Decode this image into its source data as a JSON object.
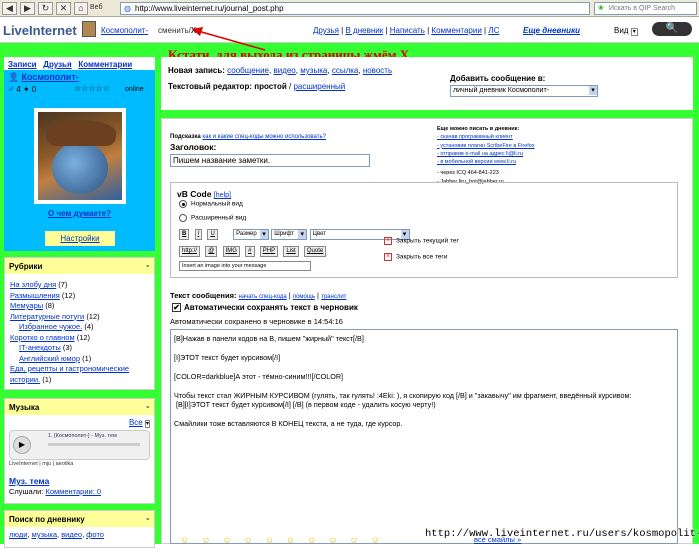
{
  "browser": {
    "web_label": "Веб",
    "url": "http://www.liveinternet.ru/journal_post.php",
    "search_placeholder": "Искать в QIP Search"
  },
  "topbar": {
    "logo": "LiveInternet",
    "username": "Космополит-",
    "change": "сменить",
    "close_x": "X",
    "links": [
      "Друзья",
      "В дневник",
      "Написать",
      "Комментарии",
      "ЛС"
    ],
    "journal_btn": "Еще дневники",
    "view_label": "Вид"
  },
  "annotations": {
    "exit_hint": "Кстати, для выхода из страницы жмём Х",
    "watermark": "http://www.liveinternet.ru/users/kosmopolit-/"
  },
  "sidebar": {
    "profile_links": [
      "Записи",
      "Друзья",
      "Комментарии"
    ],
    "username": "Космополит-",
    "stars": "☆☆☆☆☆",
    "status": "online",
    "mood_link": "О чем думаете?",
    "settings": "Настройки",
    "rubrics_title": "Рубрики",
    "rubrics": [
      {
        "name": "На злобу дня",
        "count": "(7)",
        "indent": false
      },
      {
        "name": "Размышления",
        "count": "(12)",
        "indent": false
      },
      {
        "name": "Мемуары",
        "count": "(8)",
        "indent": false
      },
      {
        "name": "Литературные потуги",
        "count": "(12)",
        "indent": false
      },
      {
        "name": "Избранное чужое.",
        "count": "(4)",
        "indent": true
      },
      {
        "name": "Коротко о главном",
        "count": "(12)",
        "indent": false
      },
      {
        "name": "IT-анекдоты",
        "count": "(3)",
        "indent": true
      },
      {
        "name": "Английский юмор",
        "count": "(1)",
        "indent": true
      },
      {
        "name": "Еда, рецепты и гастрономические истории.",
        "count": "(1)",
        "indent": false
      }
    ],
    "music_title": "Музыка",
    "music_all": "Все",
    "music_track": "1. [Космополит-] - Муз. тем",
    "music_brand": "LiveInternet",
    "music_brand2": "mju",
    "music_brand3": "aeotika",
    "music_theme": "Муз. тема",
    "listened": "Слушали:",
    "comments": "Комментарии: 0",
    "search_title": "Поиск по дневнику",
    "search_tags": [
      "люди",
      "музыка",
      "видео",
      "фото"
    ]
  },
  "header_panel": {
    "new_post": "Новая запись:",
    "types": [
      "сообщение",
      "видео",
      "музыка",
      "ссылка",
      "новость"
    ],
    "editor_label": "Текстовый редактор:",
    "editor_simple": "простой",
    "editor_ext": "расширенный",
    "add_to_label": "Добавить сообщение в:",
    "add_to_value": "личный дневник Космополит-"
  },
  "form": {
    "hint_prefix": "Подсказка",
    "hint_link": "как и какие спец-коды можно использовать?",
    "title_label": "Заголовок:",
    "title_value": "Пишем название заметки.",
    "extra_title": "Еще можно писать в дневник:",
    "extra_items": [
      "- скачав программный клиент",
      "- установив плагин ScribeFire в Firefox",
      "- отправив e-mail на адрес li@li.ru",
      "- в мобильной версии www.li.ru",
      "- через ICQ  464-841-223",
      "- Jabber liru_bot@jabber.ru"
    ],
    "vbcode": "vB Code",
    "vbhelp": "[help]",
    "mode_normal": "Нормальный вид",
    "mode_ext": "Расширенный вид",
    "fmt_buttons": [
      "B",
      "I",
      "U"
    ],
    "size_label": "Размер",
    "font_label": "Шрифт",
    "color_label": "Цвет",
    "insert_buttons": [
      "http://",
      "@",
      "IMG",
      "#",
      "PHP",
      "List",
      "Quote"
    ],
    "image_hint": "Insert an image into your message",
    "close_tag": "Закрыть текущий тег",
    "close_all": "Закрыть все теги",
    "msg_label": "Текст сообщения:",
    "msg_links": [
      "начать спец-кода",
      "помощь",
      "транслит"
    ],
    "autosave_label": "Автоматически сохранять текст в черновик",
    "autosave_status": "Автоматически сохранено в черновике в 14:54:16",
    "lines": [
      "[B]Нажав в панели кодов на В, пишем \"жирный\" текст[/B]",
      "[I]ЭТОТ текст будет курсивом[/I]",
      "[COLOR=darkblue]А этот - тёмно-синим!!![/COLOR]",
      "Чтобы текст стал ЖИРНЫМ КУРСИВОМ (гулять, так гулять! :4Eki: ), я скопирую код [/B] и \"закавычу\" им фрагмент, введённый курсивом:",
      "[B][I]ЭТОТ текст будет курсивом[/I] [/B] (в первом коде - удалить косую черту!)",
      "Смайлики тоже вставляются В КОНЕЦ текста, а не туда, где курсор."
    ],
    "all_smiles": "все смайлы »"
  },
  "colors": {
    "green": "#33ff33",
    "sky": "#00bbff",
    "yellow": "#ffff99",
    "red_annotation": "#dd0000"
  }
}
